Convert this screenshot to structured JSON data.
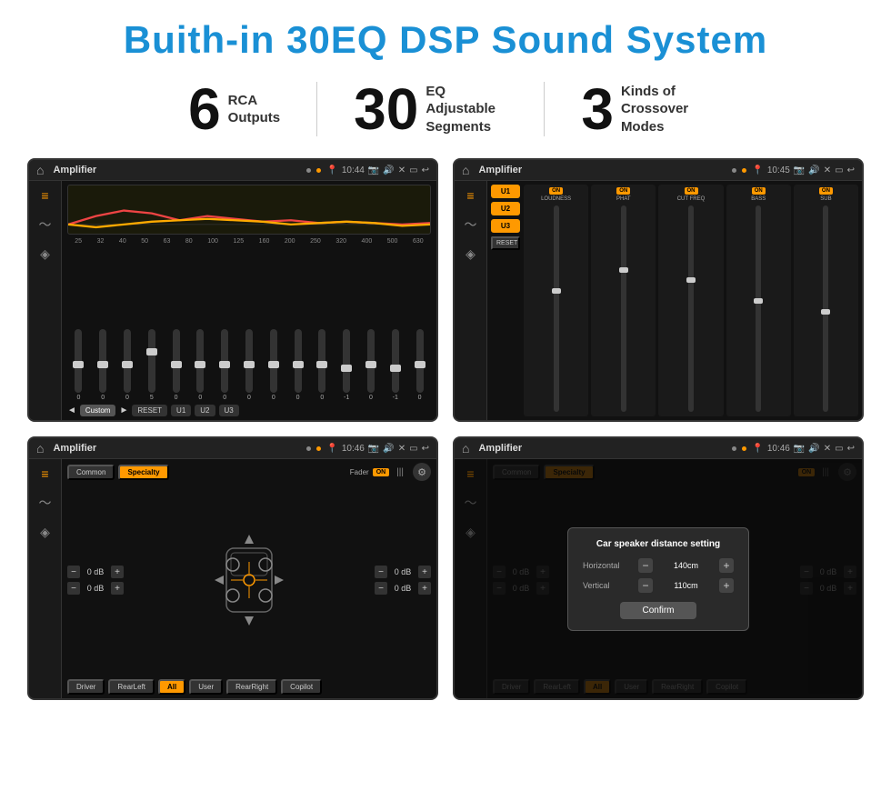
{
  "title": "Buith-in 30EQ DSP Sound System",
  "stats": [
    {
      "number": "6",
      "text": "RCA\nOutputs"
    },
    {
      "number": "30",
      "text": "EQ Adjustable\nSegments"
    },
    {
      "number": "3",
      "text": "Kinds of\nCrossover Modes"
    }
  ],
  "screens": [
    {
      "id": "screen1",
      "statusBar": {
        "appName": "Amplifier",
        "time": "10:44"
      },
      "type": "eq",
      "frequencies": [
        "25",
        "32",
        "40",
        "50",
        "63",
        "80",
        "100",
        "125",
        "160",
        "200",
        "250",
        "320",
        "400",
        "500",
        "630"
      ],
      "sliderValues": [
        "0",
        "0",
        "0",
        "5",
        "0",
        "0",
        "0",
        "0",
        "0",
        "0",
        "0",
        "-1",
        "0",
        "-1"
      ],
      "controls": [
        "◄",
        "Custom",
        "►",
        "RESET",
        "U1",
        "U2",
        "U3"
      ]
    },
    {
      "id": "screen2",
      "statusBar": {
        "appName": "Amplifier",
        "time": "10:45"
      },
      "type": "amplifier",
      "presets": [
        "U1",
        "U2",
        "U3"
      ],
      "channels": [
        {
          "label": "LOUDNESS",
          "on": true
        },
        {
          "label": "PHAT",
          "on": true
        },
        {
          "label": "CUT FREQ",
          "on": true
        },
        {
          "label": "BASS",
          "on": true
        },
        {
          "label": "SUB",
          "on": true
        }
      ],
      "resetLabel": "RESET"
    },
    {
      "id": "screen3",
      "statusBar": {
        "appName": "Amplifier",
        "time": "10:46"
      },
      "type": "fader",
      "tabs": [
        "Common",
        "Specialty"
      ],
      "faderLabel": "Fader",
      "faderOn": "ON",
      "dbValues": [
        "0 dB",
        "0 dB",
        "0 dB",
        "0 dB"
      ],
      "locations": [
        "Driver",
        "RearLeft",
        "All",
        "User",
        "RearRight",
        "Copilot"
      ]
    },
    {
      "id": "screen4",
      "statusBar": {
        "appName": "Amplifier",
        "time": "10:46"
      },
      "type": "dialog",
      "tabs": [
        "Common",
        "Specialty"
      ],
      "dialogTitle": "Car speaker distance setting",
      "horizontal": {
        "label": "Horizontal",
        "value": "140cm"
      },
      "vertical": {
        "label": "Vertical",
        "value": "110cm"
      },
      "confirmLabel": "Confirm",
      "dbValues": [
        "0 dB",
        "0 dB"
      ],
      "locations": [
        "Driver",
        "RearLeft",
        "All",
        "User",
        "RearRight",
        "Copilot"
      ]
    }
  ]
}
